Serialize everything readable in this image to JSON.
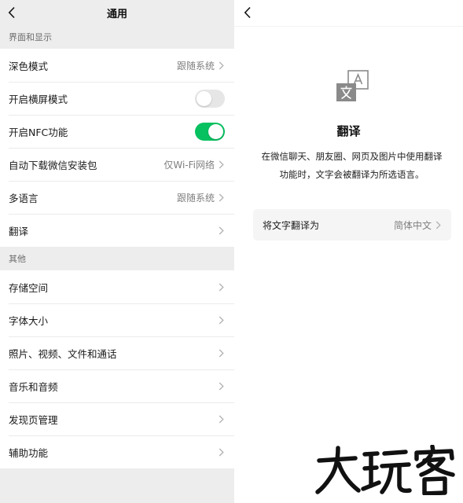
{
  "left": {
    "title": "通用",
    "sections": [
      {
        "label": "界面和显示",
        "rows": [
          {
            "label": "深色模式",
            "value": "跟随系统",
            "type": "link"
          },
          {
            "label": "开启横屏模式",
            "type": "toggle",
            "on": false
          },
          {
            "label": "开启NFC功能",
            "type": "toggle",
            "on": true
          },
          {
            "label": "自动下载微信安装包",
            "value": "仅Wi-Fi网络",
            "type": "link"
          },
          {
            "label": "多语言",
            "value": "跟随系统",
            "type": "link"
          },
          {
            "label": "翻译",
            "value": "",
            "type": "link"
          }
        ]
      },
      {
        "label": "其他",
        "rows": [
          {
            "label": "存储空间",
            "type": "link"
          },
          {
            "label": "字体大小",
            "type": "link"
          },
          {
            "label": "照片、视频、文件和通话",
            "type": "link"
          },
          {
            "label": "音乐和音频",
            "type": "link"
          },
          {
            "label": "发现页管理",
            "type": "link"
          },
          {
            "label": "辅助功能",
            "type": "link"
          }
        ]
      }
    ]
  },
  "right": {
    "icon": "translate-icon",
    "title": "翻译",
    "description_line1": "在微信聊天、朋友圈、网页及图片中使用翻译",
    "description_line2": "功能时，文字会被翻译为所选语言。",
    "setting_label": "将文字翻译为",
    "setting_value": "简体中文"
  },
  "watermark": "大玩客",
  "colors": {
    "accent": "#07c160",
    "background": "#ededed",
    "secondary_text": "#7f7f7f"
  }
}
